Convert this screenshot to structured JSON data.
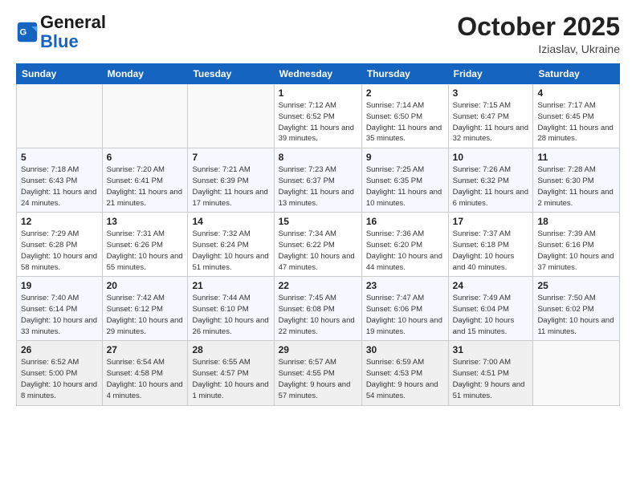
{
  "header": {
    "logo_general": "General",
    "logo_blue": "Blue",
    "month": "October 2025",
    "location": "Iziaslav, Ukraine"
  },
  "weekdays": [
    "Sunday",
    "Monday",
    "Tuesday",
    "Wednesday",
    "Thursday",
    "Friday",
    "Saturday"
  ],
  "weeks": [
    [
      {
        "day": "",
        "info": ""
      },
      {
        "day": "",
        "info": ""
      },
      {
        "day": "",
        "info": ""
      },
      {
        "day": "1",
        "info": "Sunrise: 7:12 AM\nSunset: 6:52 PM\nDaylight: 11 hours\nand 39 minutes."
      },
      {
        "day": "2",
        "info": "Sunrise: 7:14 AM\nSunset: 6:50 PM\nDaylight: 11 hours\nand 35 minutes."
      },
      {
        "day": "3",
        "info": "Sunrise: 7:15 AM\nSunset: 6:47 PM\nDaylight: 11 hours\nand 32 minutes."
      },
      {
        "day": "4",
        "info": "Sunrise: 7:17 AM\nSunset: 6:45 PM\nDaylight: 11 hours\nand 28 minutes."
      }
    ],
    [
      {
        "day": "5",
        "info": "Sunrise: 7:18 AM\nSunset: 6:43 PM\nDaylight: 11 hours\nand 24 minutes."
      },
      {
        "day": "6",
        "info": "Sunrise: 7:20 AM\nSunset: 6:41 PM\nDaylight: 11 hours\nand 21 minutes."
      },
      {
        "day": "7",
        "info": "Sunrise: 7:21 AM\nSunset: 6:39 PM\nDaylight: 11 hours\nand 17 minutes."
      },
      {
        "day": "8",
        "info": "Sunrise: 7:23 AM\nSunset: 6:37 PM\nDaylight: 11 hours\nand 13 minutes."
      },
      {
        "day": "9",
        "info": "Sunrise: 7:25 AM\nSunset: 6:35 PM\nDaylight: 11 hours\nand 10 minutes."
      },
      {
        "day": "10",
        "info": "Sunrise: 7:26 AM\nSunset: 6:32 PM\nDaylight: 11 hours\nand 6 minutes."
      },
      {
        "day": "11",
        "info": "Sunrise: 7:28 AM\nSunset: 6:30 PM\nDaylight: 11 hours\nand 2 minutes."
      }
    ],
    [
      {
        "day": "12",
        "info": "Sunrise: 7:29 AM\nSunset: 6:28 PM\nDaylight: 10 hours\nand 58 minutes."
      },
      {
        "day": "13",
        "info": "Sunrise: 7:31 AM\nSunset: 6:26 PM\nDaylight: 10 hours\nand 55 minutes."
      },
      {
        "day": "14",
        "info": "Sunrise: 7:32 AM\nSunset: 6:24 PM\nDaylight: 10 hours\nand 51 minutes."
      },
      {
        "day": "15",
        "info": "Sunrise: 7:34 AM\nSunset: 6:22 PM\nDaylight: 10 hours\nand 47 minutes."
      },
      {
        "day": "16",
        "info": "Sunrise: 7:36 AM\nSunset: 6:20 PM\nDaylight: 10 hours\nand 44 minutes."
      },
      {
        "day": "17",
        "info": "Sunrise: 7:37 AM\nSunset: 6:18 PM\nDaylight: 10 hours\nand 40 minutes."
      },
      {
        "day": "18",
        "info": "Sunrise: 7:39 AM\nSunset: 6:16 PM\nDaylight: 10 hours\nand 37 minutes."
      }
    ],
    [
      {
        "day": "19",
        "info": "Sunrise: 7:40 AM\nSunset: 6:14 PM\nDaylight: 10 hours\nand 33 minutes."
      },
      {
        "day": "20",
        "info": "Sunrise: 7:42 AM\nSunset: 6:12 PM\nDaylight: 10 hours\nand 29 minutes."
      },
      {
        "day": "21",
        "info": "Sunrise: 7:44 AM\nSunset: 6:10 PM\nDaylight: 10 hours\nand 26 minutes."
      },
      {
        "day": "22",
        "info": "Sunrise: 7:45 AM\nSunset: 6:08 PM\nDaylight: 10 hours\nand 22 minutes."
      },
      {
        "day": "23",
        "info": "Sunrise: 7:47 AM\nSunset: 6:06 PM\nDaylight: 10 hours\nand 19 minutes."
      },
      {
        "day": "24",
        "info": "Sunrise: 7:49 AM\nSunset: 6:04 PM\nDaylight: 10 hours\nand 15 minutes."
      },
      {
        "day": "25",
        "info": "Sunrise: 7:50 AM\nSunset: 6:02 PM\nDaylight: 10 hours\nand 11 minutes."
      }
    ],
    [
      {
        "day": "26",
        "info": "Sunrise: 6:52 AM\nSunset: 5:00 PM\nDaylight: 10 hours\nand 8 minutes."
      },
      {
        "day": "27",
        "info": "Sunrise: 6:54 AM\nSunset: 4:58 PM\nDaylight: 10 hours\nand 4 minutes."
      },
      {
        "day": "28",
        "info": "Sunrise: 6:55 AM\nSunset: 4:57 PM\nDaylight: 10 hours\nand 1 minute."
      },
      {
        "day": "29",
        "info": "Sunrise: 6:57 AM\nSunset: 4:55 PM\nDaylight: 9 hours\nand 57 minutes."
      },
      {
        "day": "30",
        "info": "Sunrise: 6:59 AM\nSunset: 4:53 PM\nDaylight: 9 hours\nand 54 minutes."
      },
      {
        "day": "31",
        "info": "Sunrise: 7:00 AM\nSunset: 4:51 PM\nDaylight: 9 hours\nand 51 minutes."
      },
      {
        "day": "",
        "info": ""
      }
    ]
  ]
}
